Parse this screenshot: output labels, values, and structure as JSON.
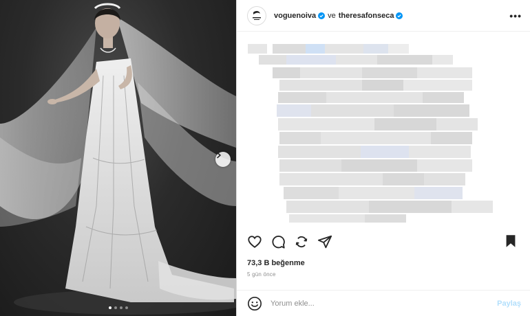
{
  "post": {
    "account": "voguenoiva",
    "conjunction": "ve",
    "collaborator": "theresafonseca",
    "avatar_text": "VOGUE",
    "more_label": "•••"
  },
  "media": {
    "icon": "chevron-right-icon",
    "slides_count": 4,
    "active_slide": 1
  },
  "engagement": {
    "likes": "73,3 B beğenme",
    "time_ago": "5 gün önce"
  },
  "comment": {
    "placeholder": "Yorum ekle...",
    "post_label": "Paylaş"
  },
  "colors": {
    "verified": "#0095f6",
    "post_button": "#b2dffc",
    "muted_text": "#8e8e8e"
  }
}
